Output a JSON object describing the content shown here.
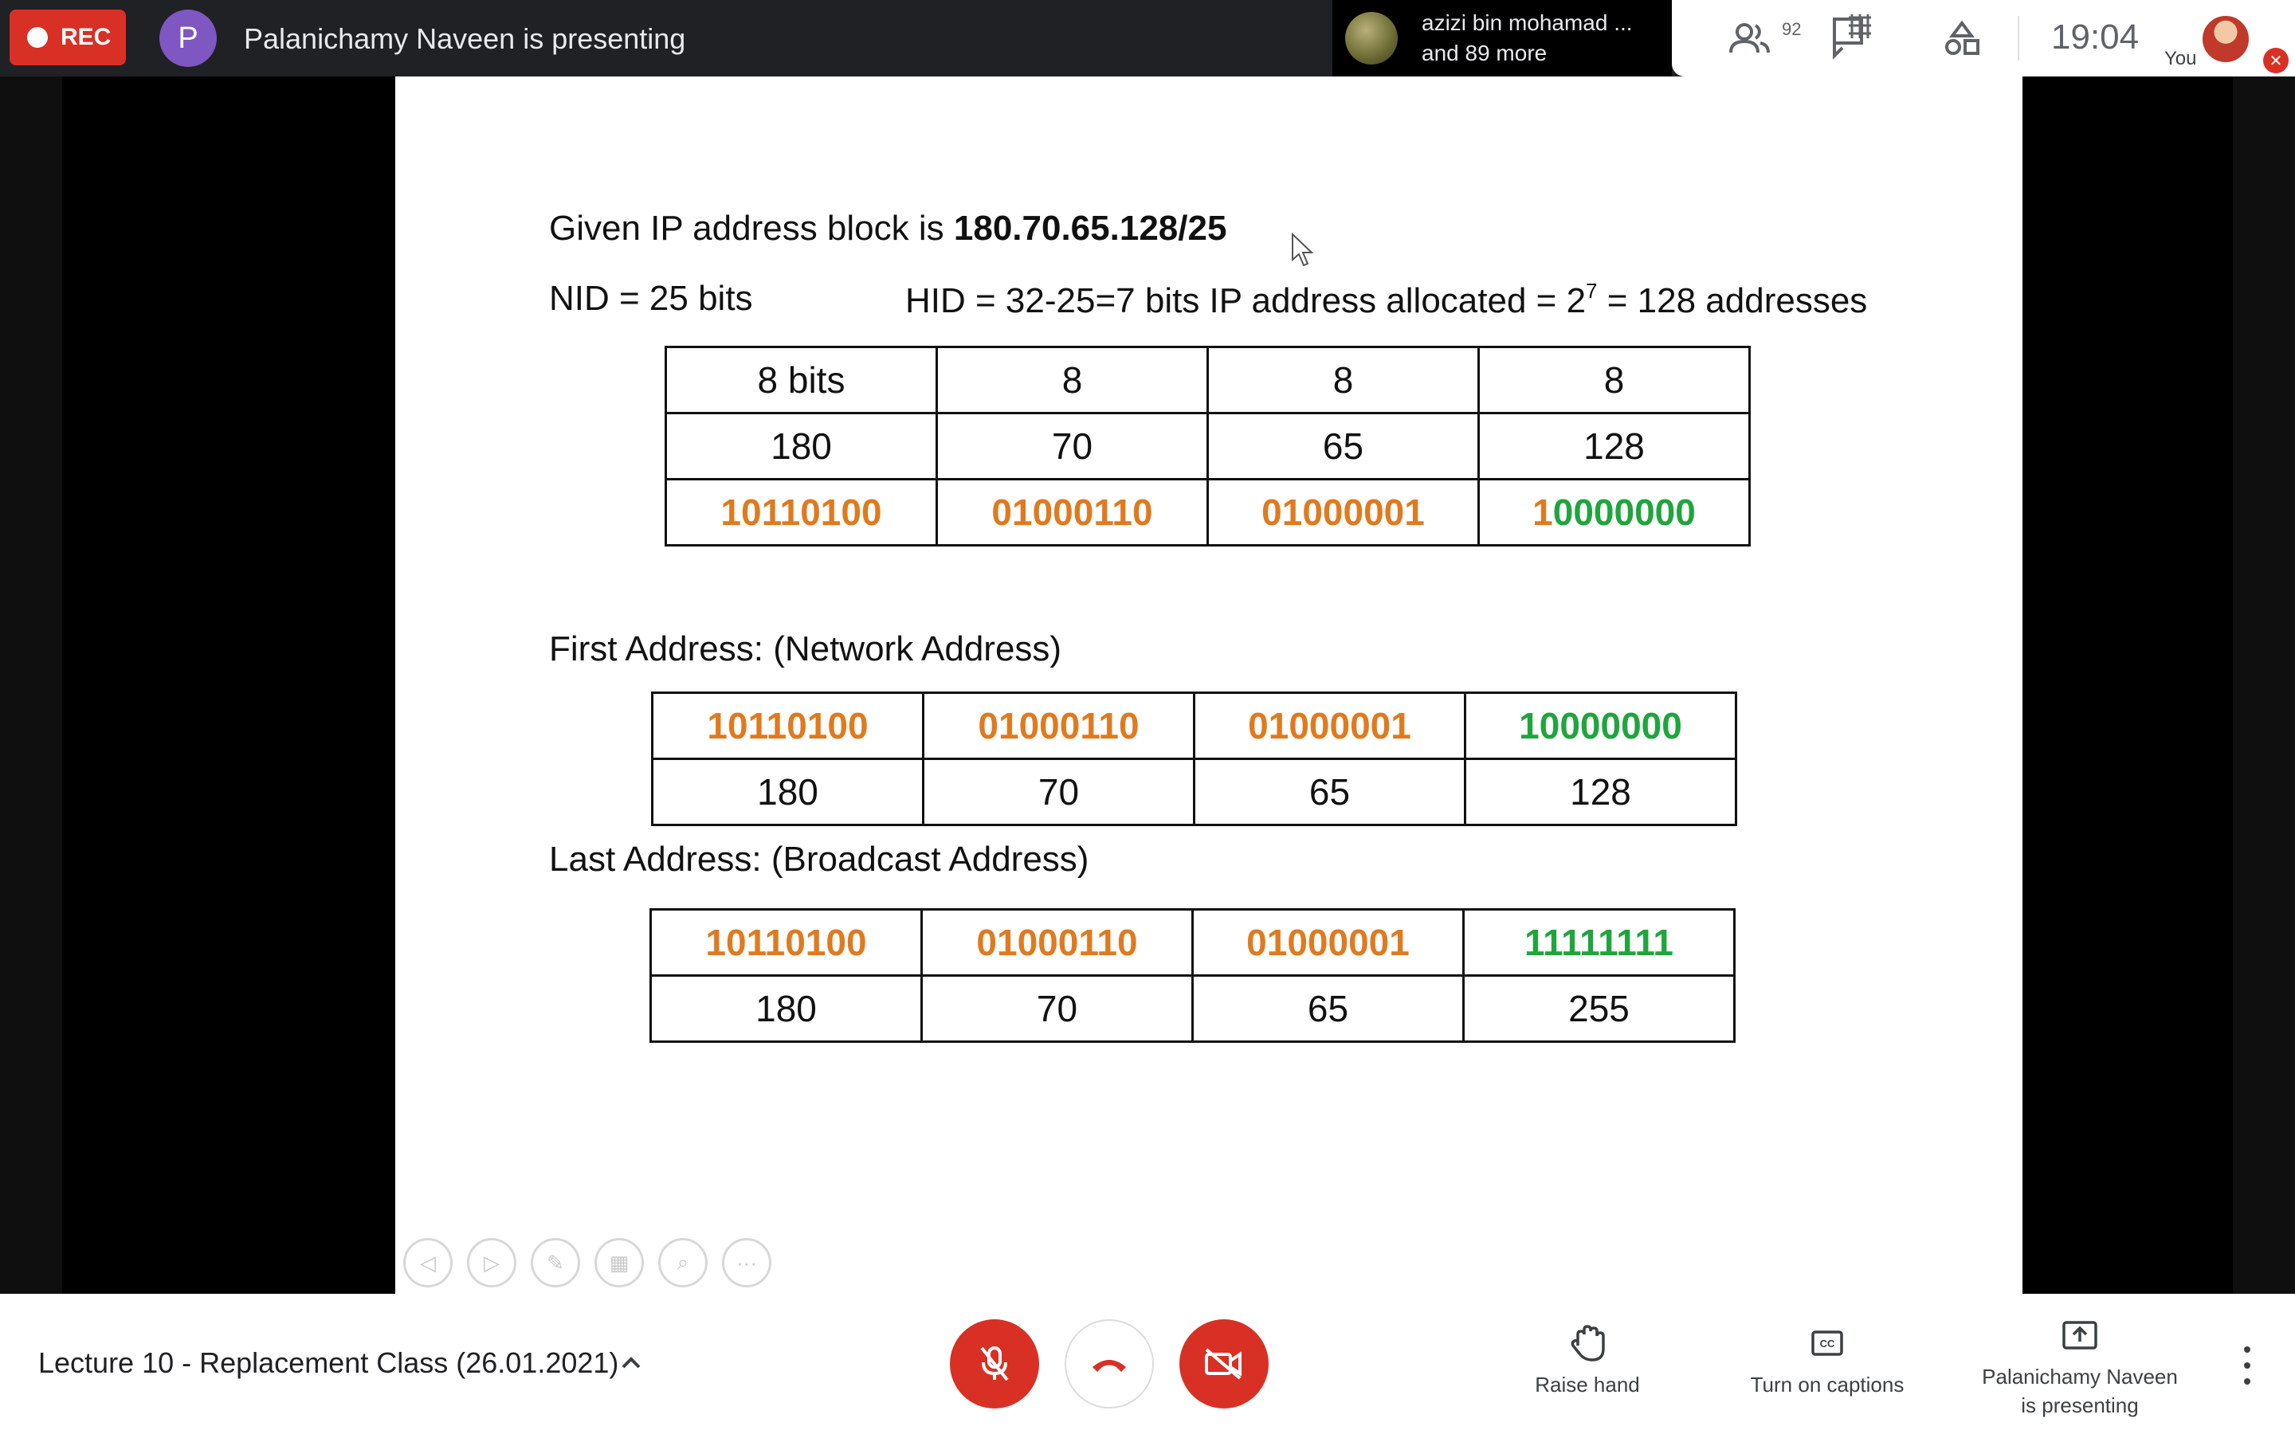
{
  "topbar": {
    "rec_label": "REC",
    "presenter_initial": "P",
    "presenting_text": "Palanichamy Naveen is presenting",
    "participant_name": "azizi bin mohamad ...",
    "participant_more": "and 89 more",
    "people_count": "92",
    "clock": "19:04",
    "you_label": "You"
  },
  "slide": {
    "given_prefix": "Given IP address block is ",
    "given_block": "180.70.65.128/25",
    "nid_line": "NID = 25 bits",
    "hid_line_before_sup": "HID = 32-25=7 bits  IP address allocated = 2",
    "hid_line_sup": "7",
    "hid_line_after_sup": " = 128 addresses",
    "table1": {
      "header": [
        "8 bits",
        "8",
        "8",
        "8"
      ],
      "decimal": [
        "180",
        "70",
        "65",
        "128"
      ],
      "binary_net": [
        "10110100",
        "01000110",
        "01000001"
      ],
      "binary_last_first_char": "1",
      "binary_last_rest": "0000000"
    },
    "first_title": "First Address: (Network Address)",
    "table2": {
      "binary": [
        "10110100",
        "01000110",
        "01000001",
        "10000000"
      ],
      "decimal": [
        "180",
        "70",
        "65",
        "128"
      ]
    },
    "last_title": "Last Address: (Broadcast Address)",
    "table3": {
      "binary": [
        "10110100",
        "01000110",
        "01000001",
        "11111111"
      ],
      "decimal": [
        "180",
        "70",
        "65",
        "255"
      ]
    }
  },
  "bottombar": {
    "meeting_title": "Lecture 10 - Replacement Class (26.01.2021)",
    "raise_hand": "Raise hand",
    "captions": "Turn on captions",
    "present_line1": "Palanichamy Naveen",
    "present_line2": "is presenting"
  },
  "colors": {
    "network_bits": "#e07a1f",
    "host_bits": "#1fa53d",
    "record_red": "#d93025"
  }
}
